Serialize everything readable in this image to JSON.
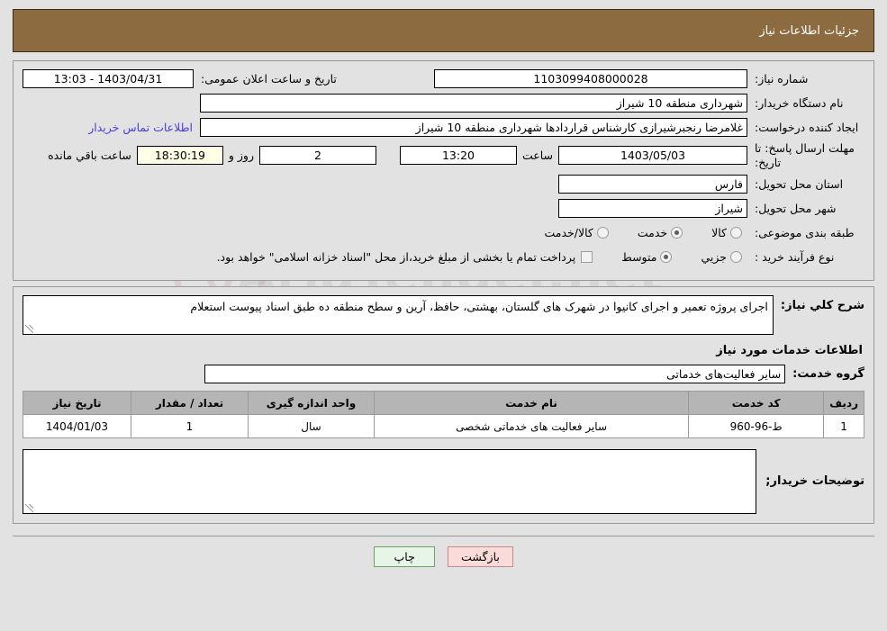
{
  "header": {
    "title": "جزئیات اطلاعات نیاز"
  },
  "form": {
    "need_number": {
      "label": "شماره نیاز:",
      "value": "1103099408000028"
    },
    "public_announce": {
      "label": "تاریخ و ساعت اعلان عمومی:",
      "value": "1403/04/31 - 13:03"
    },
    "buyer_org": {
      "label": "نام دستگاه خریدار:",
      "value": "شهرداری منطقه 10 شیراز"
    },
    "requester": {
      "label": "ایجاد کننده درخواست:",
      "value": "غلامرضا رنجبرشیرازی کارشناس قراردادها شهرداری منطقه 10 شیراز"
    },
    "contact_link": "اطلاعات تماس خریدار",
    "deadline": {
      "label": "مهلت ارسال پاسخ: تا تاریخ:",
      "date": "1403/05/03",
      "hour_label": "ساعت",
      "hour": "13:20",
      "days": "2",
      "days_label": "روز و",
      "countdown": "18:30:19",
      "remaining_label": "ساعت باقي مانده"
    },
    "province": {
      "label": "استان محل تحویل:",
      "value": "فارس"
    },
    "city": {
      "label": "شهر محل تحویل:",
      "value": "شیراز"
    },
    "category": {
      "label": "طبقه بندی موضوعی:",
      "options": [
        {
          "label": "کالا",
          "selected": false
        },
        {
          "label": "خدمت",
          "selected": true
        },
        {
          "label": "کالا/خدمت",
          "selected": false
        }
      ]
    },
    "purchase_type": {
      "label": "نوع فرآیند خرید :",
      "options": [
        {
          "label": "جزیي",
          "selected": false
        },
        {
          "label": "متوسط",
          "selected": true
        }
      ],
      "treasury_note": "پرداخت تمام یا بخشی از مبلغ خرید،از محل \"اسناد خزانه اسلامی\" خواهد بود.",
      "treasury_checked": false
    }
  },
  "description": {
    "label": "شرح كلي نياز:",
    "value": "اجرای پروژه تعمیر و اجرای کانیوا در شهرک های گلستان، بهشتی، حافظ، آرین و سطح منطقه ده طبق اسناد پیوست استعلام"
  },
  "services_section": {
    "title": "اطلاعات خدمات مورد نیاز",
    "group": {
      "label": "گروه خدمت:",
      "value": "سایر فعالیت‌های خدماتی"
    },
    "table": {
      "columns": [
        "ردیف",
        "کد خدمت",
        "نام خدمت",
        "واحد اندازه گیری",
        "تعداد / مقدار",
        "تاریخ نیاز"
      ],
      "rows": [
        {
          "row": "1",
          "code": "ط-96-960",
          "name": "سایر فعالیت های خدماتی شخصی",
          "unit": "سال",
          "qty": "1",
          "date": "1404/01/03"
        }
      ]
    }
  },
  "buyer_comments": {
    "label": "توضیحات خریدار;",
    "value": ""
  },
  "footer": {
    "print_label": "چاپ",
    "back_label": "بازگشت"
  },
  "watermark": {
    "text": "AriaTender.net"
  },
  "colors": {
    "header_bg": "#8c6b41",
    "page_bg": "#e2e2e2",
    "link": "#4a3fd6",
    "countdown_bg": "#ffffe8",
    "table_header_bg": "#b5b5b5",
    "print_btn_bg": "#e6f5e6",
    "back_btn_bg": "#fbdada"
  }
}
